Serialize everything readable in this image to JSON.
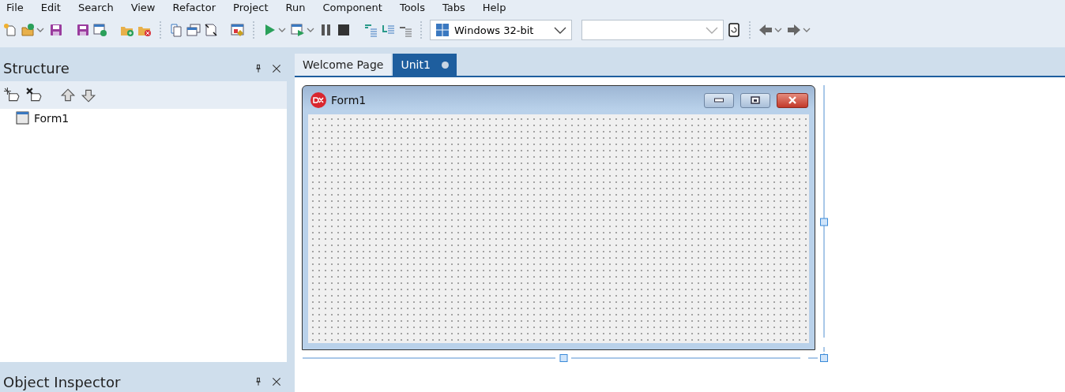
{
  "menu": [
    {
      "label": "File"
    },
    {
      "label": "Edit"
    },
    {
      "label": "Search"
    },
    {
      "label": "View"
    },
    {
      "label": "Refactor"
    },
    {
      "label": "Project"
    },
    {
      "label": "Run"
    },
    {
      "label": "Component"
    },
    {
      "label": "Tools"
    },
    {
      "label": "Tabs"
    },
    {
      "label": "Help"
    }
  ],
  "toolbar": {
    "platform": "Windows 32-bit"
  },
  "structure": {
    "title": "Structure",
    "items": [
      {
        "label": "Form1"
      }
    ]
  },
  "tabs": [
    {
      "label": "Welcome Page",
      "selected": false,
      "modified": false
    },
    {
      "label": "Unit1",
      "selected": true,
      "modified": true
    }
  ],
  "form": {
    "title": "Form1"
  },
  "object_inspector": {
    "title": "Object Inspector"
  }
}
